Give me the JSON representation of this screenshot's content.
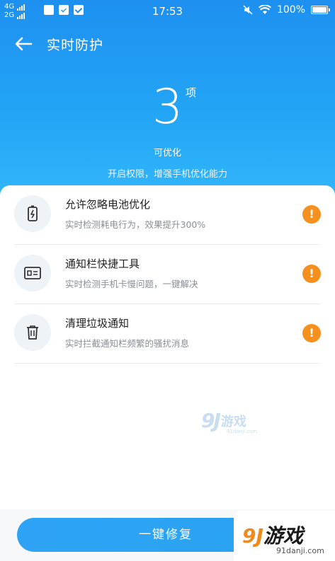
{
  "status_bar": {
    "net1": "4G",
    "net2": "2G",
    "time": "17:53",
    "battery": "100%"
  },
  "header": {
    "title": "实时防护",
    "back_icon": "arrow-left-icon"
  },
  "summary": {
    "count": "3",
    "unit": "项",
    "caption": "可优化",
    "hint": "开启权限，增强手机优化能力"
  },
  "items": [
    {
      "title": "允许忽略电池优化",
      "desc": "实时检测耗电行为，效果提升300%",
      "icon": "battery-charging-icon",
      "status": "!"
    },
    {
      "title": "通知栏快捷工具",
      "desc": "实时检测手机卡慢问题，一键解决",
      "icon": "id-card-icon",
      "status": "!"
    },
    {
      "title": "清理垃圾通知",
      "desc": "实时拦截通知栏频繁的骚扰消息",
      "icon": "trash-icon",
      "status": "!"
    }
  ],
  "watermark": {
    "logo": "9J",
    "text": "游戏",
    "url": "91danji.com"
  },
  "action": {
    "fix_label": "一键修复"
  },
  "corner_logo": {
    "logo": "9J",
    "text": "游戏",
    "url": "91danji.com"
  },
  "colors": {
    "primary": "#1e90f0",
    "warning": "#f5901e"
  }
}
